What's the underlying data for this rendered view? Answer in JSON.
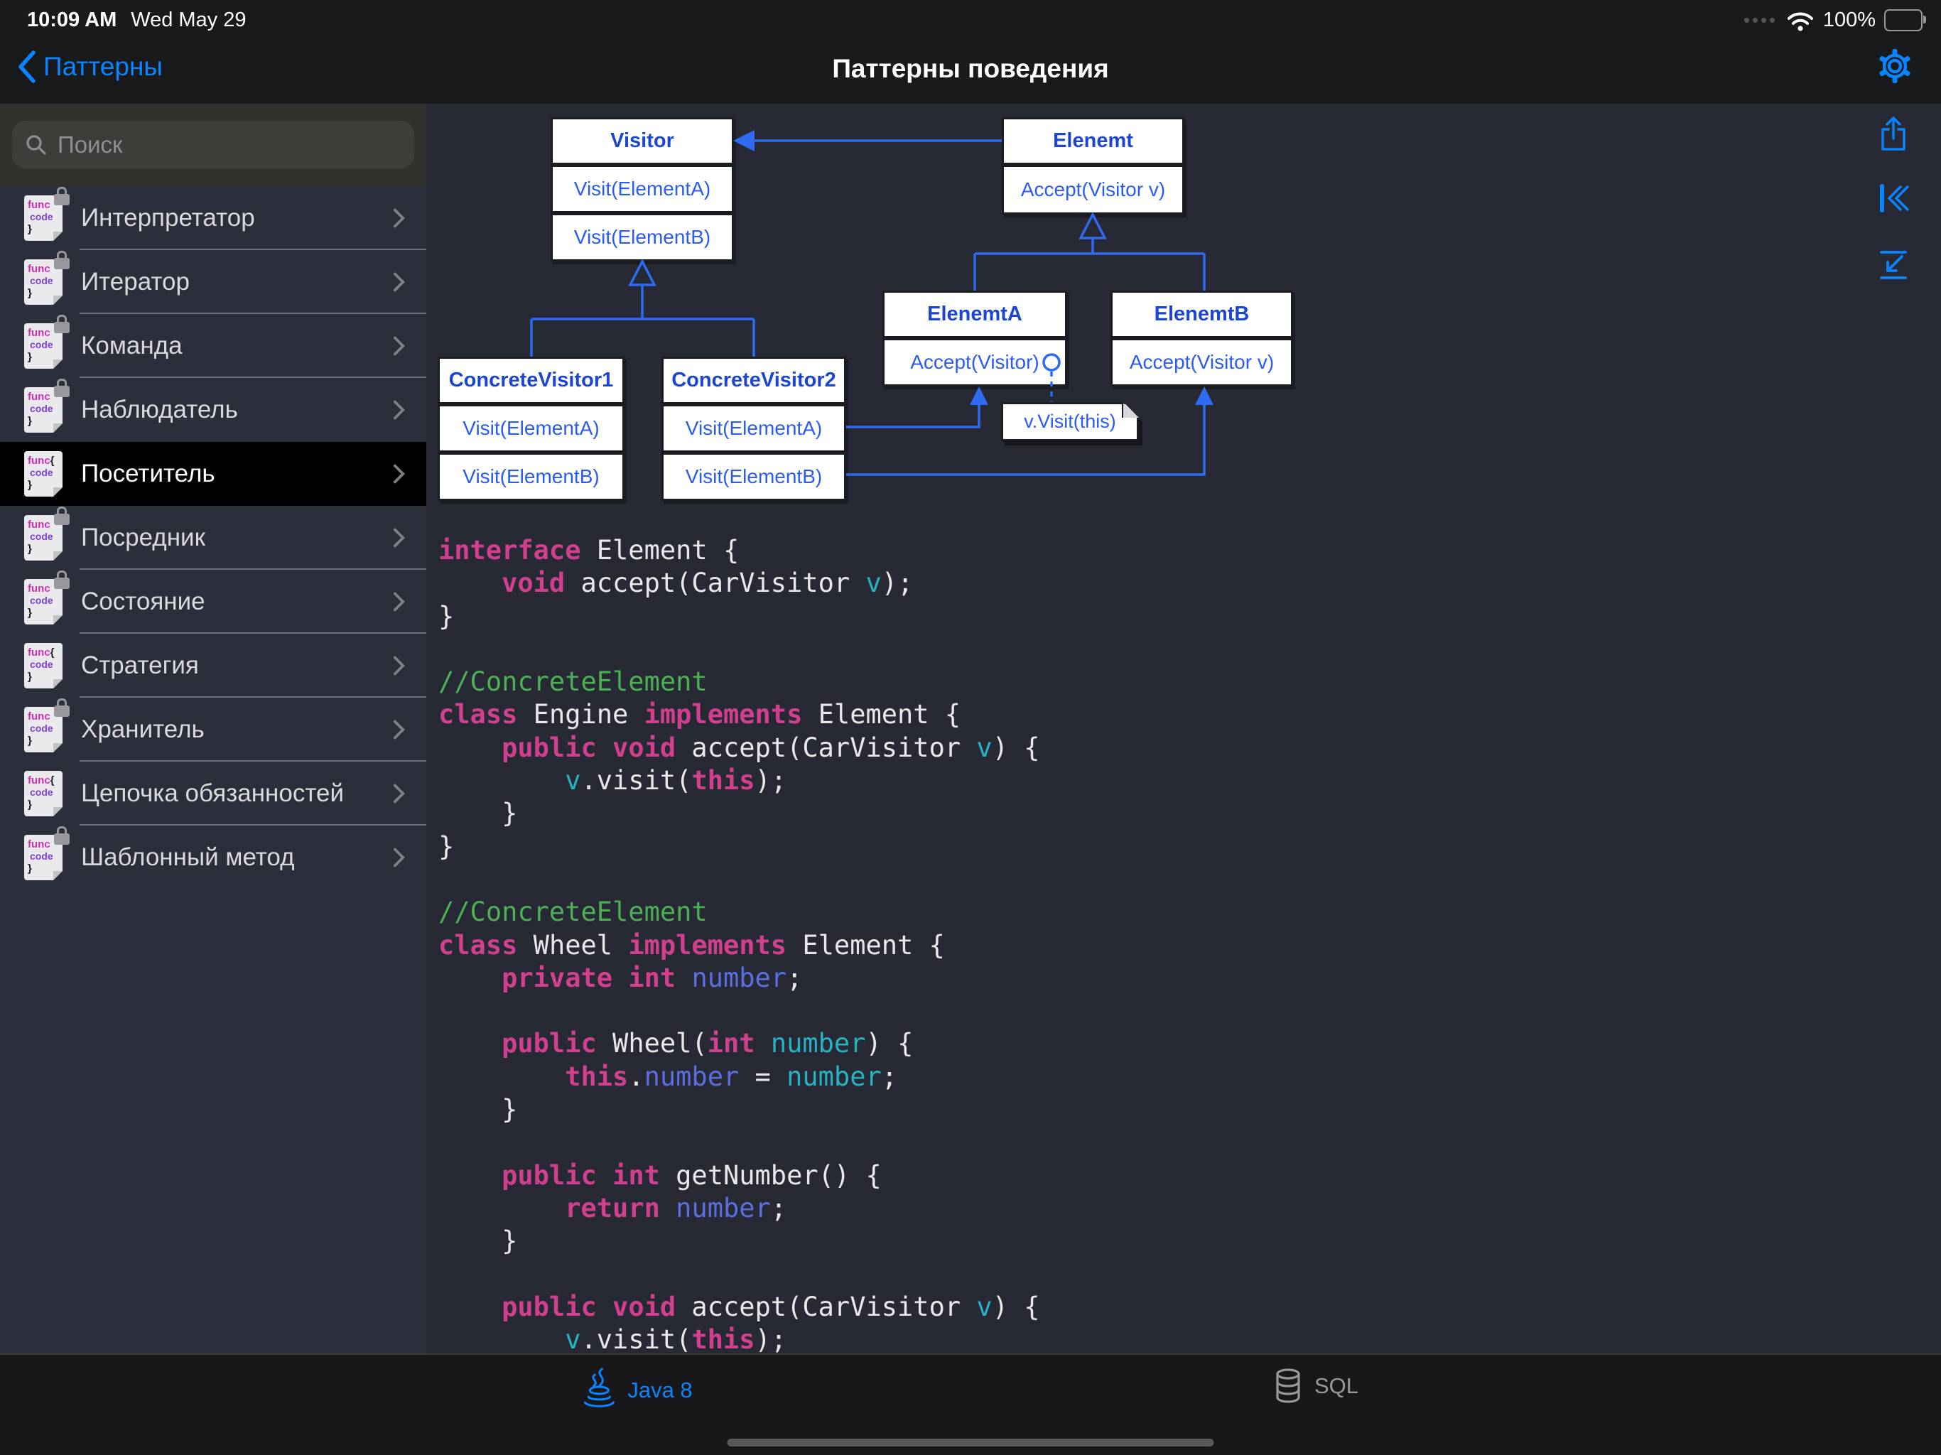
{
  "status_bar": {
    "time": "10:09 AM",
    "date": "Wed May 29",
    "battery_percent": "100%"
  },
  "navbar": {
    "back_label": "Паттерны",
    "title": "Паттерны поведения"
  },
  "sidebar": {
    "search_placeholder": "Поиск",
    "doc_icon_text": {
      "line1": "func",
      "brace": "{",
      "line2": "code",
      "line3": "}"
    },
    "items": [
      {
        "label": "Интерпретатор",
        "locked": true,
        "selected": false
      },
      {
        "label": "Итератор",
        "locked": true,
        "selected": false
      },
      {
        "label": "Команда",
        "locked": true,
        "selected": false
      },
      {
        "label": "Наблюдатель",
        "locked": true,
        "selected": false
      },
      {
        "label": "Посетитель",
        "locked": false,
        "selected": true
      },
      {
        "label": "Посредник",
        "locked": true,
        "selected": false
      },
      {
        "label": "Состояние",
        "locked": true,
        "selected": false
      },
      {
        "label": "Стратегия",
        "locked": false,
        "selected": false
      },
      {
        "label": "Хранитель",
        "locked": true,
        "selected": false
      },
      {
        "label": "Цепочка обязанностей",
        "locked": false,
        "selected": false
      },
      {
        "label": "Шаблонный метод",
        "locked": true,
        "selected": false
      }
    ]
  },
  "diagram": {
    "boxes": [
      {
        "title": "Visitor",
        "rows": [
          "Visit(ElementA)",
          "Visit(ElementB)"
        ]
      },
      {
        "title": "Elenemt",
        "rows": [
          "Accept(Visitor v)"
        ]
      },
      {
        "title": "ElenemtA",
        "rows": [
          "Accept(Visitor)"
        ]
      },
      {
        "title": "ElenemtB",
        "rows": [
          "Accept(Visitor v)"
        ]
      },
      {
        "title": "ConcreteVisitor1",
        "rows": [
          "Visit(ElementA)",
          "Visit(ElementB)"
        ]
      },
      {
        "title": "ConcreteVisitor2",
        "rows": [
          "Visit(ElementA)",
          "Visit(ElementB)"
        ]
      }
    ],
    "note": "v.Visit(this)"
  },
  "code": {
    "lines": [
      [
        [
          "kw",
          "interface"
        ],
        [
          "pl",
          " Element {"
        ]
      ],
      [
        [
          "pl",
          "    "
        ],
        [
          "kw",
          "void"
        ],
        [
          "pl",
          " accept(CarVisitor "
        ],
        [
          "cy",
          "v"
        ],
        [
          "pl",
          ");"
        ]
      ],
      [
        [
          "pl",
          "}"
        ]
      ],
      [],
      [
        [
          "cm",
          "//ConcreteElement"
        ]
      ],
      [
        [
          "kw",
          "class"
        ],
        [
          "pl",
          " Engine "
        ],
        [
          "kw",
          "implements"
        ],
        [
          "pl",
          " Element {"
        ]
      ],
      [
        [
          "pl",
          "    "
        ],
        [
          "kw",
          "public"
        ],
        [
          "pl",
          " "
        ],
        [
          "kw",
          "void"
        ],
        [
          "pl",
          " accept(CarVisitor "
        ],
        [
          "cy",
          "v"
        ],
        [
          "pl",
          ") {"
        ]
      ],
      [
        [
          "pl",
          "        "
        ],
        [
          "cy",
          "v"
        ],
        [
          "pl",
          ".visit("
        ],
        [
          "kw",
          "this"
        ],
        [
          "pl",
          ");"
        ]
      ],
      [
        [
          "pl",
          "    }"
        ]
      ],
      [
        [
          "pl",
          "}"
        ]
      ],
      [],
      [
        [
          "cm",
          "//ConcreteElement"
        ]
      ],
      [
        [
          "kw",
          "class"
        ],
        [
          "pl",
          " Wheel "
        ],
        [
          "kw",
          "implements"
        ],
        [
          "pl",
          " Element {"
        ]
      ],
      [
        [
          "pl",
          "    "
        ],
        [
          "kw",
          "private"
        ],
        [
          "pl",
          " "
        ],
        [
          "kw",
          "int"
        ],
        [
          "pl",
          " "
        ],
        [
          "fl",
          "number"
        ],
        [
          "pl",
          ";"
        ]
      ],
      [],
      [
        [
          "pl",
          "    "
        ],
        [
          "kw",
          "public"
        ],
        [
          "pl",
          " Wheel("
        ],
        [
          "kw",
          "int"
        ],
        [
          "pl",
          " "
        ],
        [
          "cy",
          "number"
        ],
        [
          "pl",
          ") {"
        ]
      ],
      [
        [
          "pl",
          "        "
        ],
        [
          "kw",
          "this"
        ],
        [
          "pl",
          "."
        ],
        [
          "fl",
          "number"
        ],
        [
          "pl",
          " = "
        ],
        [
          "cy",
          "number"
        ],
        [
          "pl",
          ";"
        ]
      ],
      [
        [
          "pl",
          "    }"
        ]
      ],
      [],
      [
        [
          "pl",
          "    "
        ],
        [
          "kw",
          "public"
        ],
        [
          "pl",
          " "
        ],
        [
          "kw",
          "int"
        ],
        [
          "pl",
          " getNumber() {"
        ]
      ],
      [
        [
          "pl",
          "        "
        ],
        [
          "kw",
          "return"
        ],
        [
          "pl",
          " "
        ],
        [
          "fl",
          "number"
        ],
        [
          "pl",
          ";"
        ]
      ],
      [
        [
          "pl",
          "    }"
        ]
      ],
      [],
      [
        [
          "pl",
          "    "
        ],
        [
          "kw",
          "public"
        ],
        [
          "pl",
          " "
        ],
        [
          "kw",
          "void"
        ],
        [
          "pl",
          " accept(CarVisitor "
        ],
        [
          "cy",
          "v"
        ],
        [
          "pl",
          ") {"
        ]
      ],
      [
        [
          "pl",
          "        "
        ],
        [
          "cy",
          "v"
        ],
        [
          "pl",
          ".visit("
        ],
        [
          "kw",
          "this"
        ],
        [
          "pl",
          ");"
        ]
      ]
    ]
  },
  "tabbar": {
    "tabs": [
      {
        "label": "Java 8",
        "active": true
      },
      {
        "label": "SQL",
        "active": false
      }
    ]
  },
  "colors": {
    "accent_blue": "#0a84ff",
    "diagram_title_blue": "#1c46d2",
    "diagram_line_blue": "#2e6bf2",
    "keyword_magenta": "#d0408e",
    "comment_green": "#4caf54",
    "param_cyan": "#27b2c4",
    "field_blue": "#5a6fe0",
    "selected_row_bg": "#000000"
  },
  "icons": {
    "navbar_right": "gear",
    "content_actions": [
      "share",
      "skip-to-start",
      "collapse-down-left"
    ],
    "tab_icons": [
      "java-cup",
      "sql-database"
    ]
  }
}
